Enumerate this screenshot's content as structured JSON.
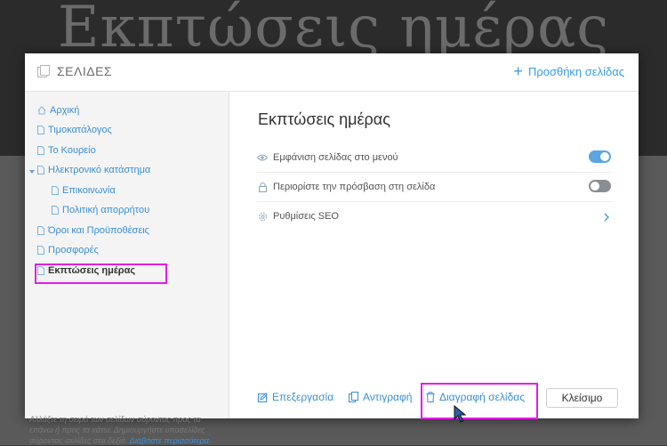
{
  "background": {
    "title": "Εκπτώσεις ημέρας"
  },
  "header": {
    "title": "ΣΕΛΙΔΕΣ",
    "add_page": "Προσθήκη σελίδας"
  },
  "sidebar": {
    "items": [
      {
        "label": "Αρχική"
      },
      {
        "label": "Τιμοκατάλογος"
      },
      {
        "label": "Το Κουρείο"
      },
      {
        "label": "Ηλεκτρονικό κατάστημα"
      },
      {
        "label": "Επικοινωνία"
      },
      {
        "label": "Πολιτική απορρήτου"
      },
      {
        "label": "Όροι και Προϋποθέσεις"
      },
      {
        "label": "Προσφορές"
      },
      {
        "label": "Εκπτώσεις ημέρας"
      }
    ],
    "help_text": "Αλλάξτε τη σειρά των σελίδων σύροντας προς τα επάνω ή προς τα κάτω. Δημιουργήστε υποσελίδες σύροντας σελίδες στα δεξιά.",
    "help_link": "Διαβάστε περισσότερα."
  },
  "main": {
    "title": "Εκπτώσεις ημέρας",
    "settings": [
      {
        "label": "Εμφάνιση σελίδας στο μενού",
        "enabled": true
      },
      {
        "label": "Περιορίστε την πρόσβαση στη σελίδα",
        "enabled": false
      },
      {
        "label": "Ρυθμίσεις SEO"
      }
    ]
  },
  "footer": {
    "edit": "Επεξεργασία",
    "copy": "Αντιγραφή",
    "delete": "Διαγραφή σελίδας",
    "close": "Κλείσιμο"
  },
  "colors": {
    "accent": "#3a9ee4",
    "highlight": "#e21ee8",
    "toggle_on": "#5ba6e0",
    "toggle_off": "#8a8e93"
  },
  "icons": [
    "pages-icon",
    "home-icon",
    "page-icon",
    "eye-icon",
    "lock-icon",
    "gear-icon",
    "chevron-right-icon",
    "edit-icon",
    "copy-icon",
    "trash-icon",
    "cursor-icon"
  ]
}
